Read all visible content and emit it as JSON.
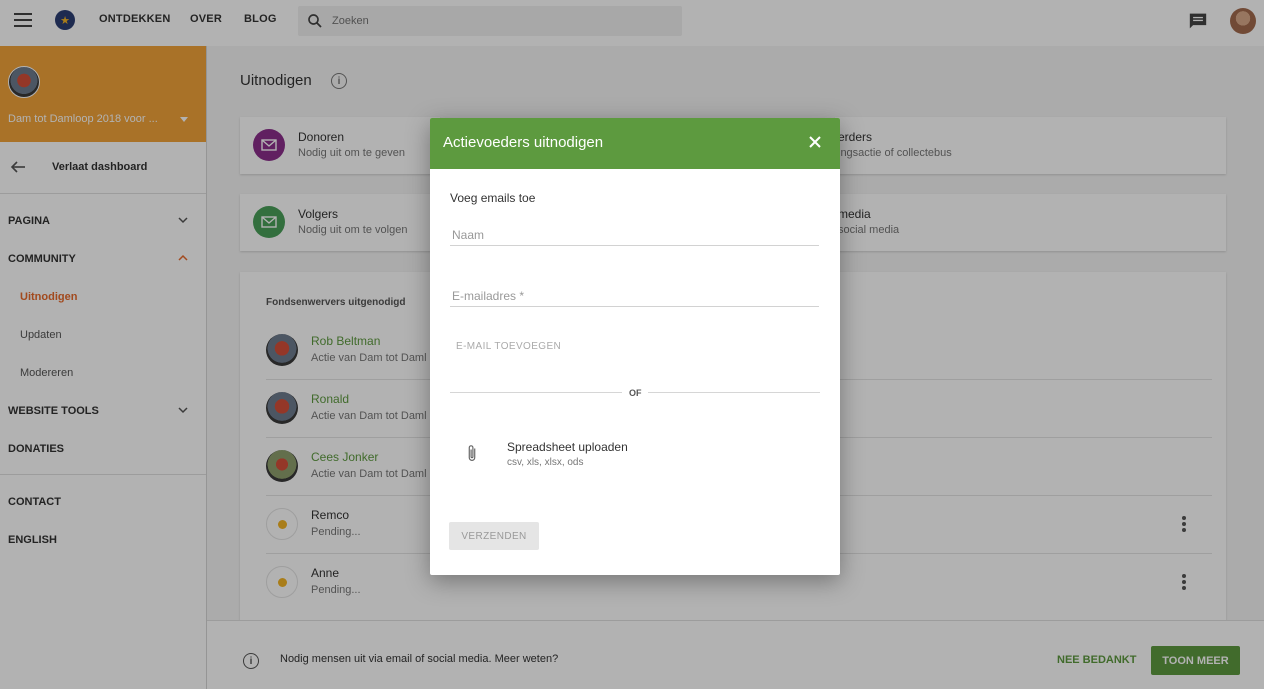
{
  "topbar": {
    "nav": [
      "ONTDEKKEN",
      "OVER",
      "BLOG"
    ],
    "search_placeholder": "Zoeken"
  },
  "sidebar": {
    "campaign_name": "Dam tot Damloop 2018 voor ...",
    "leave_label": "Verlaat dashboard",
    "items": [
      {
        "label": "PAGINA"
      },
      {
        "label": "COMMUNITY"
      },
      {
        "label": "Uitnodigen"
      },
      {
        "label": "Updaten"
      },
      {
        "label": "Modereren"
      },
      {
        "label": "WEBSITE TOOLS"
      },
      {
        "label": "DONATIES"
      },
      {
        "label": "CONTACT"
      },
      {
        "label": "ENGLISH"
      }
    ]
  },
  "main": {
    "title": "Uitnodigen",
    "cards": [
      {
        "title": "Donoren",
        "sub": "Nodig uit om te geven"
      },
      {
        "title": "Volgers",
        "sub": "Nodig uit om te volgen"
      },
      {
        "title": "erders",
        "sub": "ingsactie of collectebus"
      },
      {
        "title": "media",
        "sub": "social media"
      }
    ],
    "list_heading": "Fondsenwervers uitgenodigd",
    "rows": [
      {
        "name": "Rob Beltman",
        "sub": "Actie van Dam tot Daml"
      },
      {
        "name": "Ronald",
        "sub": "Actie van Dam tot Daml"
      },
      {
        "name": "Cees Jonker",
        "sub": "Actie van Dam tot Daml"
      },
      {
        "name": "Remco",
        "sub": "Pending..."
      },
      {
        "name": "Anne",
        "sub": "Pending..."
      }
    ]
  },
  "bottom": {
    "text": "Nodig mensen uit via email of social media. Meer weten?",
    "decline": "NEE BEDANKT",
    "more": "TOON MEER"
  },
  "modal": {
    "title": "Actievoeders uitnodigen",
    "section": "Voeg emails toe",
    "name_placeholder": "Naam",
    "email_placeholder": "E-mailadres *",
    "add_email": "E-MAIL TOEVOEGEN",
    "or": "OF",
    "upload_title": "Spreadsheet uploaden",
    "upload_formats": "csv, xls, xlsx, ods",
    "send": "VERZENDEN"
  },
  "colors": {
    "accent_green": "#5d9a3f",
    "campaign_orange": "#f2a43a",
    "active_orange": "#e86a2c",
    "donor_purple": "#8b2f8c"
  }
}
